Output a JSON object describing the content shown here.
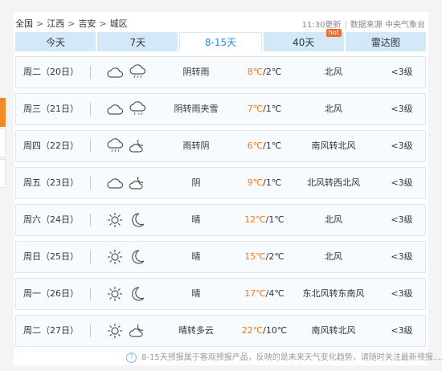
{
  "breadcrumb": [
    "全国",
    "江西",
    "吉安",
    "城区"
  ],
  "update_time": "11:30更新",
  "source": "数据来源 中央气象台",
  "tabs": [
    {
      "label": "今天",
      "active": false,
      "hot": false
    },
    {
      "label": "7天",
      "active": false,
      "hot": false
    },
    {
      "label": "8-15天",
      "active": true,
      "hot": false
    },
    {
      "label": "40天",
      "active": false,
      "hot": true
    },
    {
      "label": "雷达图",
      "active": false,
      "hot": false
    }
  ],
  "hot_badge": "hot",
  "forecast": [
    {
      "day": "周二（20日）",
      "icons": [
        "cloud-icon",
        "rain-icon"
      ],
      "weather": "阴转雨",
      "high": "8℃",
      "low": "/2℃",
      "wind": "北风",
      "level": "<3级"
    },
    {
      "day": "周三（21日）",
      "icons": [
        "cloud-icon",
        "sleet-icon"
      ],
      "weather": "阴转雨夹雪",
      "high": "7℃",
      "low": "/1℃",
      "wind": "北风",
      "level": "<3级"
    },
    {
      "day": "周四（22日）",
      "icons": [
        "rain-icon",
        "partly-cloudy-night-icon"
      ],
      "weather": "雨转阴",
      "high": "6℃",
      "low": "/1℃",
      "wind": "南风转北风",
      "level": "<3级"
    },
    {
      "day": "周五（23日）",
      "icons": [
        "cloud-icon",
        "partly-cloudy-night-icon"
      ],
      "weather": "阴",
      "high": "9℃",
      "low": "/1℃",
      "wind": "北风转西北风",
      "level": "<3级"
    },
    {
      "day": "周六（24日）",
      "icons": [
        "sun-icon",
        "moon-icon"
      ],
      "weather": "晴",
      "high": "12℃",
      "low": "/1℃",
      "wind": "北风",
      "level": "<3级"
    },
    {
      "day": "周日（25日）",
      "icons": [
        "sun-icon",
        "moon-icon"
      ],
      "weather": "晴",
      "high": "15℃",
      "low": "/2℃",
      "wind": "北风",
      "level": "<3级"
    },
    {
      "day": "周一（26日）",
      "icons": [
        "sun-icon",
        "moon-icon"
      ],
      "weather": "晴",
      "high": "17℃",
      "low": "/4℃",
      "wind": "东北风转东南风",
      "level": "<3级"
    },
    {
      "day": "周二（27日）",
      "icons": [
        "sun-icon",
        "partly-cloudy-night-icon"
      ],
      "weather": "晴转多云",
      "high": "22℃",
      "low": "/10℃",
      "wind": "南风转北风",
      "level": "<3级"
    }
  ],
  "footer_note": "8-15天预报属于客观预报产品，反映的是未来天气变化趋势，请随时关注最新预报......",
  "colors": {
    "accent": "#2a8be0",
    "temp_high": "#f07a1a",
    "tab_bg": "#d3e9f8",
    "side_tab": "#f08a24"
  }
}
